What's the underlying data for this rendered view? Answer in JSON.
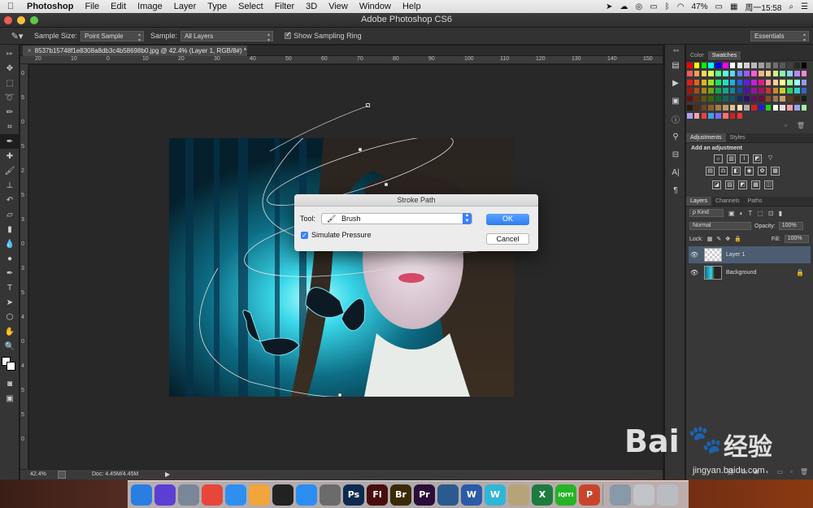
{
  "menubar": {
    "app": "Photoshop",
    "items": [
      "File",
      "Edit",
      "Image",
      "Layer",
      "Type",
      "Select",
      "Filter",
      "3D",
      "View",
      "Window",
      "Help"
    ],
    "battery": "47%",
    "clock": "周一15:58"
  },
  "window": {
    "title": "Adobe Photoshop CS6"
  },
  "options": {
    "sample_size_label": "Sample Size:",
    "sample_size_value": "Point Sample",
    "sample_label": "Sample:",
    "sample_value": "All Layers",
    "show_ring_label": "Show Sampling Ring",
    "workspace": "Essentials"
  },
  "document": {
    "tab": "8537b15748f1e8308a8db3c4b58698b0.jpg @ 42.4% (Layer 1, RGB/8#) *",
    "ruler_h": [
      "20",
      "10",
      "0",
      "10",
      "20",
      "30",
      "40",
      "50",
      "60",
      "70",
      "80",
      "90",
      "100",
      "110",
      "120",
      "130",
      "140",
      "150"
    ],
    "ruler_v": [
      "0",
      "5",
      "0",
      "5",
      "2",
      "5",
      "3",
      "0",
      "3",
      "5",
      "4",
      "0",
      "4",
      "5",
      "5",
      "0"
    ],
    "zoom": "42.4%",
    "doc_size": "Doc: 4.45M/4.45M"
  },
  "dialog": {
    "title": "Stroke Path",
    "tool_label": "Tool:",
    "tool_value": "Brush",
    "simulate_label": "Simulate Pressure",
    "ok": "OK",
    "cancel": "Cancel"
  },
  "panels": {
    "color_tab": "Color",
    "swatches_tab": "Swatches",
    "adjust_tab": "Adjustments",
    "styles_tab": "Styles",
    "add_adjustment": "Add an adjustment",
    "layers_tab": "Layers",
    "channels_tab": "Channels",
    "paths_tab": "Paths",
    "kind": "ρ Kind",
    "blend_mode": "Normal",
    "opacity_label": "Opacity:",
    "opacity_value": "100%",
    "lock_label": "Lock:",
    "fill_label": "Fill:",
    "fill_value": "100%",
    "layers": [
      "Layer 1",
      "Background"
    ]
  },
  "dock": {
    "apps": [
      {
        "name": "finder-icon",
        "label": "",
        "color": "#2a7de1"
      },
      {
        "name": "siri-icon",
        "label": "",
        "color": "#5b3fd3"
      },
      {
        "name": "launchpad-icon",
        "label": "",
        "color": "#7a8799"
      },
      {
        "name": "chrome-icon",
        "label": "",
        "color": "#e8463a"
      },
      {
        "name": "safari-icon",
        "label": "",
        "color": "#2e8ff0"
      },
      {
        "name": "photos-icon",
        "label": "",
        "color": "#f2a53a"
      },
      {
        "name": "qq-icon",
        "label": "",
        "color": "#222222"
      },
      {
        "name": "appstore-icon",
        "label": "",
        "color": "#2c8df0"
      },
      {
        "name": "system-preferences-icon",
        "label": "",
        "color": "#6b6b6b"
      },
      {
        "name": "photoshop-icon",
        "label": "Ps",
        "color": "#0e2a4f"
      },
      {
        "name": "flash-icon",
        "label": "Fl",
        "color": "#4a0d0d"
      },
      {
        "name": "bridge-icon",
        "label": "Br",
        "color": "#3a2a08"
      },
      {
        "name": "premiere-icon",
        "label": "Pr",
        "color": "#2a0d38"
      },
      {
        "name": "quicktime-icon",
        "label": "",
        "color": "#2b5a8e"
      },
      {
        "name": "word-icon",
        "label": "W",
        "color": "#2b5aa8"
      },
      {
        "name": "wps-icon",
        "label": "W",
        "color": "#2fb6d6"
      },
      {
        "name": "preview-icon",
        "label": "",
        "color": "#b6a37a"
      },
      {
        "name": "excel-icon",
        "label": "X",
        "color": "#1f7a3f"
      },
      {
        "name": "iqiyi-icon",
        "label": "iQIYI",
        "color": "#27b327"
      },
      {
        "name": "powerpoint-icon",
        "label": "P",
        "color": "#c8452c"
      },
      {
        "name": "spacer",
        "label": "",
        "color": "transparent"
      },
      {
        "name": "screenshot-icon",
        "label": "",
        "color": "#8899aa"
      },
      {
        "name": "documents-icon",
        "label": "",
        "color": "#c0c4c8"
      },
      {
        "name": "trash-icon",
        "label": "",
        "color": "#b9bdc2"
      }
    ]
  },
  "watermark": {
    "brand": "Bai",
    "brand2": "经验",
    "url": "jingyan.baidu.com"
  }
}
